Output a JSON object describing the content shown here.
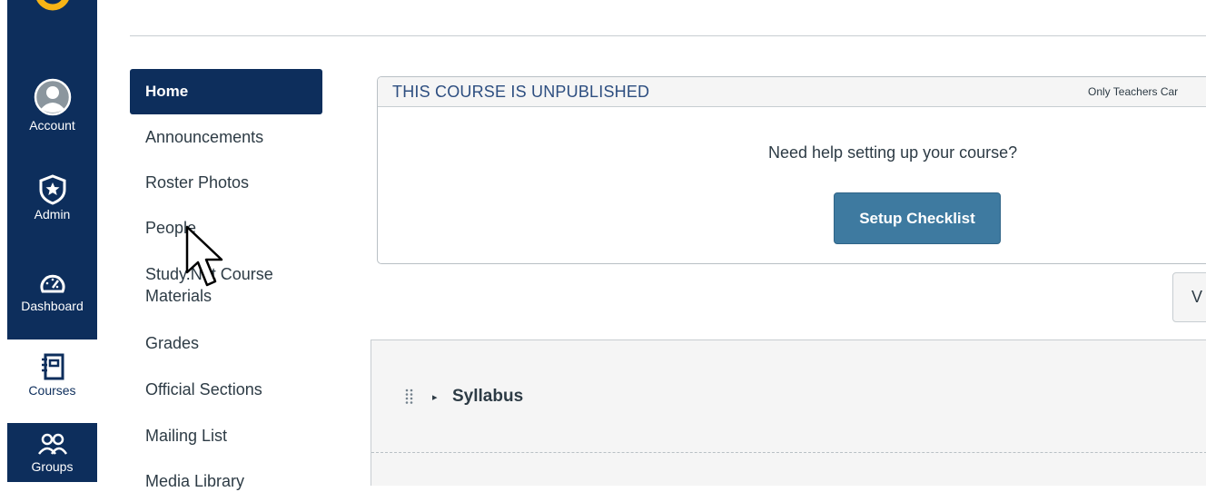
{
  "global_nav": {
    "items": [
      {
        "label": "Account",
        "icon": "account-avatar-icon"
      },
      {
        "label": "Admin",
        "icon": "shield-star-icon"
      },
      {
        "label": "Dashboard",
        "icon": "speedometer-icon"
      },
      {
        "label": "Courses",
        "icon": "book-icon"
      },
      {
        "label": "Groups",
        "icon": "groups-icon"
      }
    ],
    "active": "Courses",
    "colors": {
      "background": "#0d2e5c",
      "logo": "#f7b416"
    }
  },
  "course_nav": {
    "items": [
      {
        "label": "Home"
      },
      {
        "label": "Announcements"
      },
      {
        "label": "Roster Photos"
      },
      {
        "label": "People"
      },
      {
        "label": "Study.Net Course Materials"
      },
      {
        "label": "Grades"
      },
      {
        "label": "Official Sections"
      },
      {
        "label": "Mailing List"
      },
      {
        "label": "Media Library"
      }
    ],
    "active": "Home"
  },
  "publish_box": {
    "title": "THIS COURSE IS UNPUBLISHED",
    "note": "Only Teachers Car",
    "help_text": "Need help setting up your course?",
    "button_label": "Setup Checklist"
  },
  "view_button": {
    "label": "V"
  },
  "modules": {
    "items": [
      {
        "title": "Syllabus"
      }
    ]
  }
}
